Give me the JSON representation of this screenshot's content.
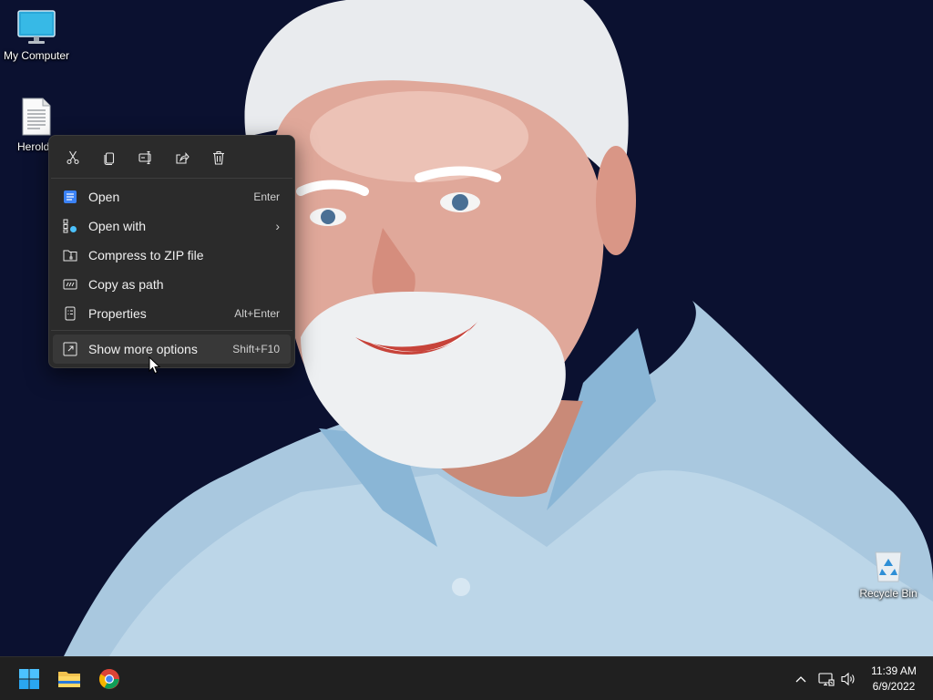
{
  "desktop": {
    "icons": [
      {
        "label": "My Computer"
      },
      {
        "label": "Herold.t"
      },
      {
        "label": "Recycle Bin"
      }
    ]
  },
  "context_menu": {
    "toolbar": [
      {
        "icon": "cut-icon"
      },
      {
        "icon": "copy-icon"
      },
      {
        "icon": "rename-icon"
      },
      {
        "icon": "share-icon"
      },
      {
        "icon": "delete-icon"
      }
    ],
    "items": [
      {
        "label": "Open",
        "shortcut": "Enter",
        "icon": "notepad-icon"
      },
      {
        "label": "Open with",
        "shortcut": "",
        "icon": "open-with-icon",
        "submenu": true
      },
      {
        "label": "Compress to ZIP file",
        "shortcut": "",
        "icon": "zip-folder-icon"
      },
      {
        "label": "Copy as path",
        "shortcut": "",
        "icon": "copy-path-icon"
      },
      {
        "label": "Properties",
        "shortcut": "Alt+Enter",
        "icon": "properties-icon"
      },
      {
        "label": "Show more options",
        "shortcut": "Shift+F10",
        "icon": "more-options-icon"
      }
    ]
  },
  "taskbar": {
    "apps": [
      {
        "icon": "windows-start-icon"
      },
      {
        "icon": "file-explorer-icon"
      },
      {
        "icon": "chrome-icon"
      }
    ],
    "tray": {
      "time": "11:39 AM",
      "date": "6/9/2022"
    }
  },
  "colors": {
    "menu_bg": "#2b2b2b",
    "taskbar_bg": "#202020",
    "accent": "#4cc2ff",
    "desktop_bg": "#0b1130"
  }
}
